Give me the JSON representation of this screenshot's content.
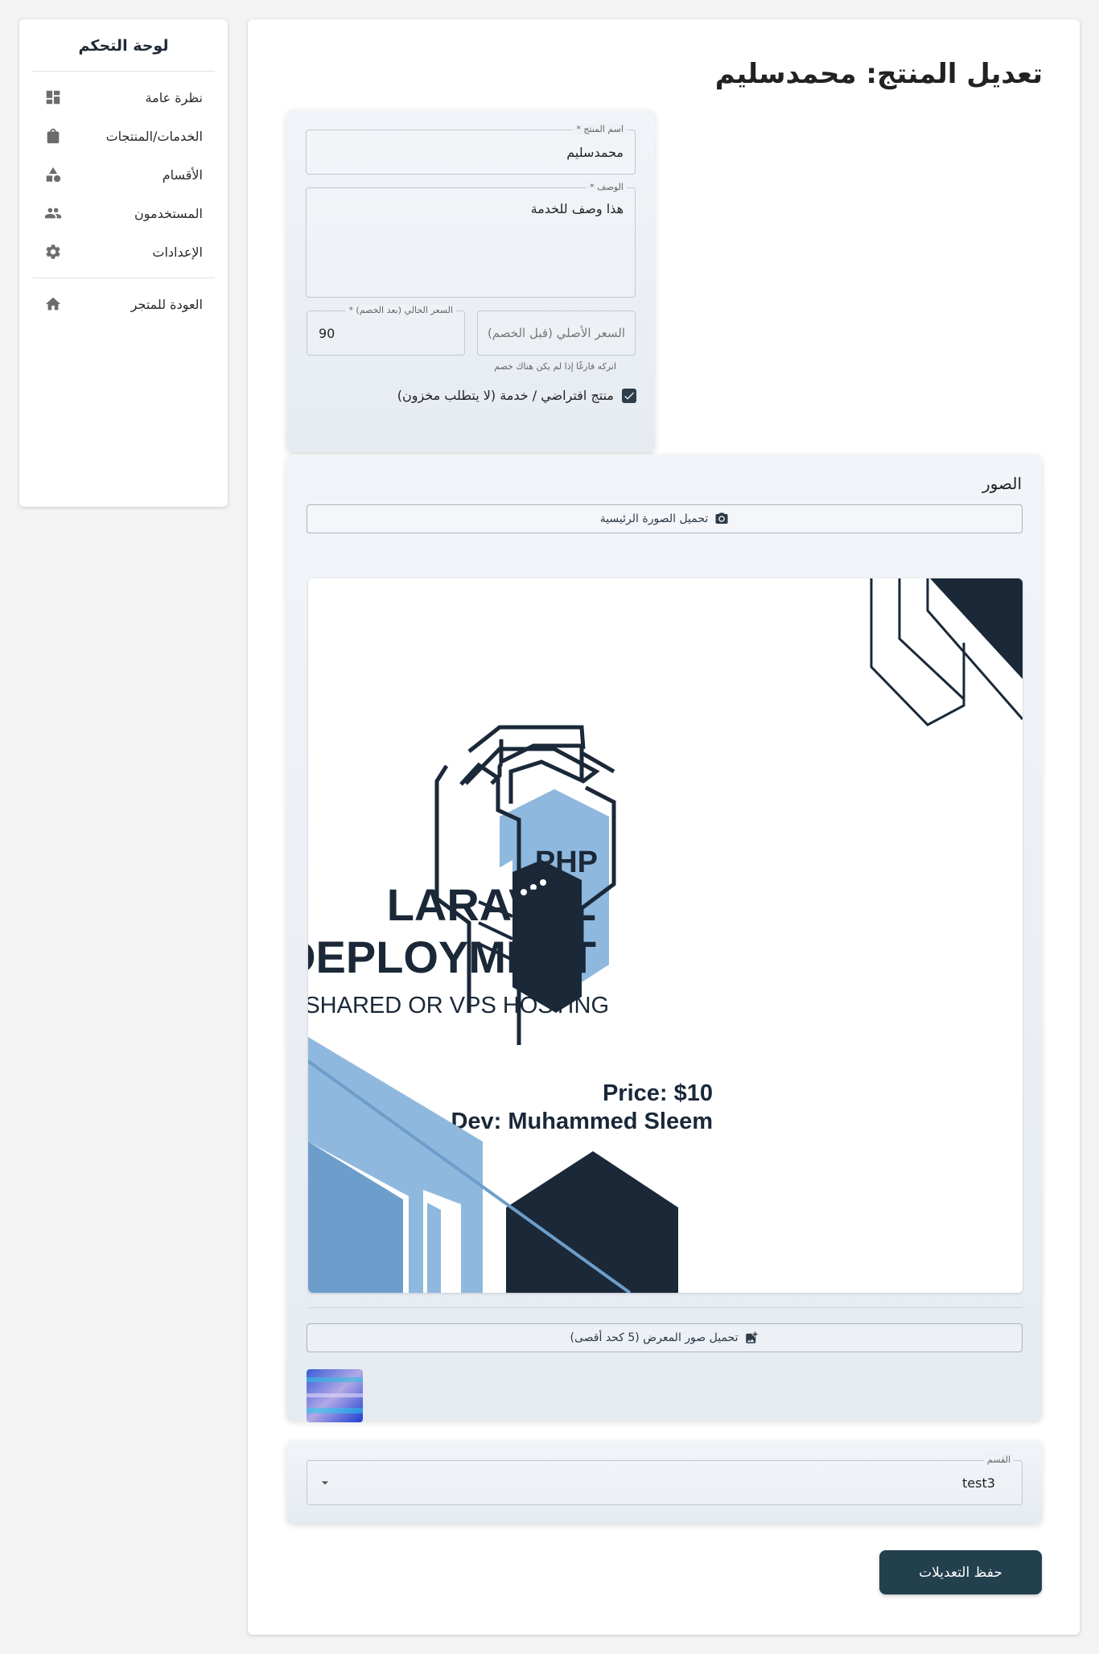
{
  "sidebar": {
    "title": "لوحة التحكم",
    "items": [
      {
        "label": "نظرة عامة",
        "icon": "dashboard-icon"
      },
      {
        "label": "الخدمات/المنتجات",
        "icon": "shopping-bag-icon"
      },
      {
        "label": "الأقسام",
        "icon": "category-icon"
      },
      {
        "label": "المستخدمون",
        "icon": "people-icon"
      },
      {
        "label": "الإعدادات",
        "icon": "gear-icon"
      }
    ],
    "back": {
      "label": "العودة للمتجر",
      "icon": "home-icon"
    }
  },
  "page": {
    "title": "تعديل المنتج: محمدسليم"
  },
  "form": {
    "name": {
      "label": "اسم المنتج *",
      "value": "محمدسليم"
    },
    "description": {
      "label": "الوصف *",
      "value": "هذا وصف للخدمة"
    },
    "current_price": {
      "label": "السعر الحالي (بعد الخصم) *",
      "value": "90"
    },
    "original_price": {
      "placeholder": "السعر الأصلي (قبل الخصم)",
      "helper": "اتركه فارغًا إذا لم يكن هناك خصم"
    },
    "virtual": {
      "label": "منتج افتراضي / خدمة (لا يتطلب مخزون)",
      "checked": true
    }
  },
  "images": {
    "title": "الصور",
    "upload_main_label": "تحميل الصورة الرئيسية",
    "upload_gallery_label": "تحميل صور المعرض (5 كحد أقصى)",
    "main_image": {
      "php": "PHP",
      "line1": "LARAVEL",
      "line2": "DEPLOYMENT",
      "subtitle": "SHARED OR VPS HOSTING",
      "price": "Price: $10",
      "dev": "Dev: Muhammed Sleem",
      "colors": {
        "dark": "#1a2838",
        "light_blue": "#8fb8de",
        "mid_blue": "#6d9ecb"
      }
    }
  },
  "category": {
    "label": "القسم",
    "value": "test3"
  },
  "save_label": "حفظ التعديلات",
  "colors": {
    "primary": "#23404f",
    "panel": "#e9eef4"
  }
}
